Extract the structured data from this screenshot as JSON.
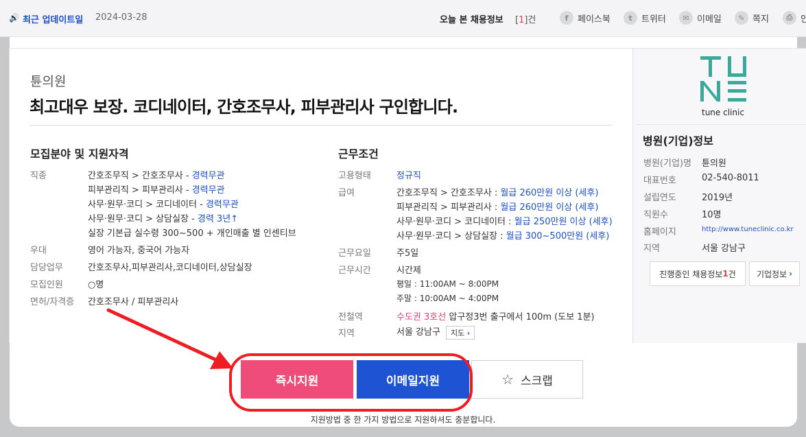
{
  "topbar": {
    "update_label": "최근 업데이트일",
    "update_date": "2024-03-28",
    "today_label": "오늘 본 채용정보",
    "today_count_open": "[",
    "today_count": "1",
    "today_count_close": "]건",
    "shares": [
      {
        "label": "페이스북",
        "icon": "facebook-icon",
        "glyph": "f"
      },
      {
        "label": "트위터",
        "icon": "twitter-icon",
        "glyph": "t"
      },
      {
        "label": "이메일",
        "icon": "mail-icon",
        "glyph": "✉"
      },
      {
        "label": "쪽지",
        "icon": "message-icon",
        "glyph": "✎"
      },
      {
        "label": "인",
        "icon": "print-icon",
        "glyph": "⎙"
      }
    ]
  },
  "job": {
    "company": "튠의원",
    "title": "최고대우 보장. 코디네이터, 간호조무사, 피부관리사 구인합니다."
  },
  "qualification": {
    "heading": "모집분야 및 지원자격",
    "rows": [
      {
        "label": "직종",
        "lines": [
          [
            "간호조무직 > 간호조무사 - ",
            "경력무관"
          ],
          [
            "피부관리직 > 피부관리사 - ",
            "경력무관"
          ],
          [
            "사무·원무·코디 > 코디네이터 - ",
            "경력무관"
          ],
          [
            "사무·원무·코디 > 상담실장 - ",
            "경력 3년↑"
          ],
          [
            "실장 기본급 실수령 300~500 + 개인매출 별 인센티브",
            ""
          ]
        ]
      },
      {
        "label": "우대",
        "value": "영어 가능자, 중국어 가능자"
      },
      {
        "label": "담당업무",
        "value": "간호조무사,피부관리사,코디네이터,상담실장"
      },
      {
        "label": "모집인원",
        "value": "○명"
      },
      {
        "label": "면허/자격증",
        "value": "간호조무사 / 피부관리사"
      }
    ]
  },
  "conditions": {
    "heading": "근무조건",
    "employment_label": "고용형태",
    "employment_value": "정규직",
    "salary_label": "급여",
    "salary_lines": [
      [
        "간호조무직 > 간호조무사 : ",
        "월급 260만원 이상 (세후)"
      ],
      [
        "피부관리직 > 피부관리사 : ",
        "월급 260만원 이상 (세후)"
      ],
      [
        "사무·원무·코디 > 코디네이터 : ",
        "월급 250만원 이상 (세후)"
      ],
      [
        "사무·원무·코디 > 상담실장 : ",
        "월급 300~500만원 (세후)"
      ]
    ],
    "days_label": "근무요일",
    "days_value": "주5일",
    "hours_label": "근무시간",
    "hours_lines": [
      "시간제",
      "평일 : 11:00AM ~ 8:00PM",
      "주말 : 10:00AM ~ 4:00PM"
    ],
    "subway_label": "전철역",
    "subway_line": "수도권 3호선",
    "subway_value": "압구정3번 출구에서 100m (도보 1분)",
    "region_label": "지역",
    "region_value": "서울 강남구",
    "map_button": "지도"
  },
  "side": {
    "logo_text": "tune clinic",
    "heading": "병원(기업)정보",
    "rows": [
      {
        "label": "병원(기업)명",
        "value": "튠의원"
      },
      {
        "label": "대표번호",
        "value": "02-540-8011"
      },
      {
        "label": "설립연도",
        "value": "2019년"
      },
      {
        "label": "직원수",
        "value": "10명"
      },
      {
        "label": "홈페이지",
        "value": "http://www.tuneclinic.co.kr"
      },
      {
        "label": "지역",
        "value": "서울 강남구"
      }
    ],
    "jobs_button_prefix": "진행중인 채용정보 ",
    "jobs_button_count": "1",
    "jobs_button_suffix": "건",
    "company_button": "기업정보"
  },
  "actions": {
    "apply": "즉시지원",
    "email": "이메일지원",
    "scrap": "스크랩",
    "hint": "지원방법 중 한 가지 방법으로 지원하셔도 충분합니다."
  },
  "colors": {
    "accent_blue": "#1e53d4",
    "apply_pink": "#ef4c79",
    "annotation_red": "#ee1d24",
    "logo_teal": "#3aa99a"
  }
}
